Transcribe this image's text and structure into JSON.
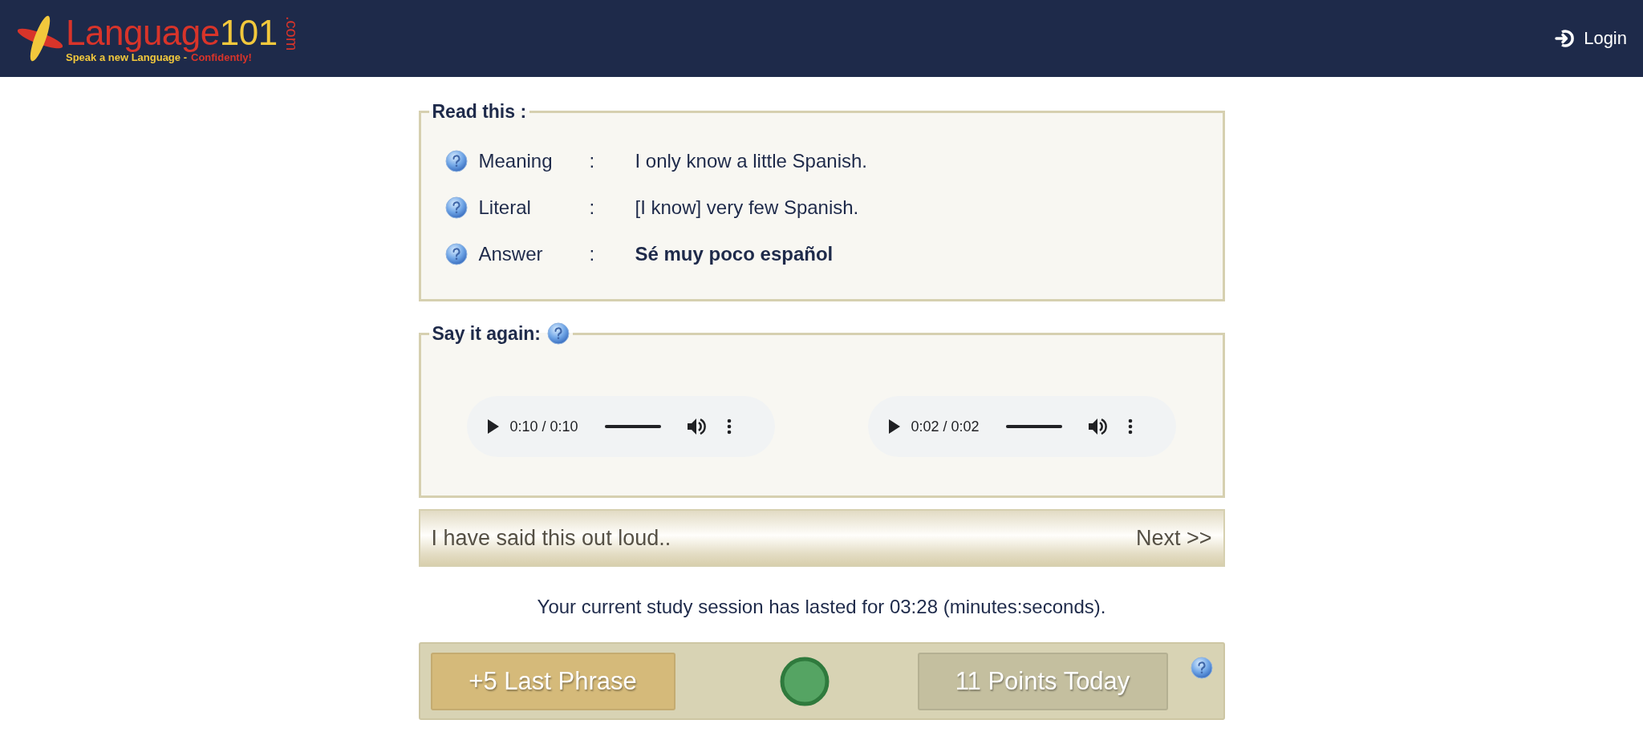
{
  "header": {
    "logo": {
      "name": "Language",
      "number": "101",
      "domain": ".com",
      "tagline": "Speak a new Language -",
      "tagline_emphasis": "Confidently!"
    },
    "login": "Login"
  },
  "read_panel": {
    "title": "Read this :",
    "rows": [
      {
        "label": "Meaning",
        "separator": ":",
        "value": "I only know a little Spanish.",
        "bold": false
      },
      {
        "label": "Literal",
        "separator": ":",
        "value": "[I know] very few Spanish.",
        "bold": false
      },
      {
        "label": "Answer",
        "separator": ":",
        "value": "Sé muy poco español",
        "bold": true
      }
    ]
  },
  "say_panel": {
    "title": "Say it again:",
    "players": [
      {
        "time": "0:10 / 0:10",
        "level": 1
      },
      {
        "time": "0:02 / 0:02",
        "level": 1
      }
    ]
  },
  "confirm_bar": {
    "label": "I have said this out loud..",
    "next": "Next >>"
  },
  "session_text": "Your current study session has lasted for 03:28 (minutes:seconds).",
  "score_bar": {
    "last_phrase": "+5 Last Phrase",
    "points_today": "11 Points Today"
  }
}
